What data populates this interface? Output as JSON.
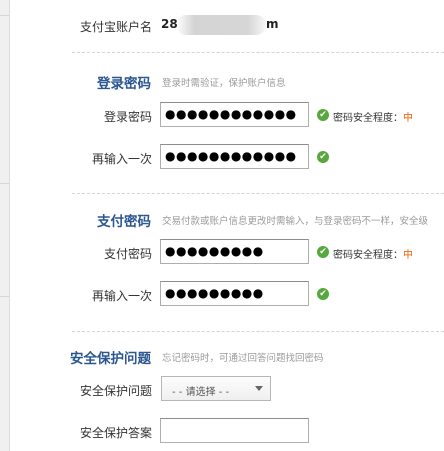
{
  "account": {
    "label": "支付宝账户名",
    "value_prefix": "28",
    "value_suffix": "m"
  },
  "login_section": {
    "title": "登录密码",
    "hint": "登录时需验证，保护账户信息",
    "password_label": "登录密码",
    "password_value": "●●●●●●●●●●●●",
    "confirm_label": "再输入一次",
    "confirm_value": "●●●●●●●●●●●●",
    "strength_label": "密码安全程度：",
    "strength_level": "中"
  },
  "pay_section": {
    "title": "支付密码",
    "hint": "交易付款或账户信息更改时需输入，与登录密码不一样，安全级",
    "password_label": "支付密码",
    "password_value": "●●●●●●●●●",
    "confirm_label": "再输入一次",
    "confirm_value": "●●●●●●●●●",
    "strength_label": "密码安全程度：",
    "strength_level": "中"
  },
  "security_section": {
    "title": "安全保护问题",
    "hint": "忘记密码时，可通过回答问题找回密码",
    "question_label": "安全保护问题",
    "question_select": "- - 请选择 - -",
    "answer_label": "安全保护答案",
    "answer_value": ""
  },
  "icons": {
    "check": "check-circle-icon",
    "dropdown": "chevron-down-icon"
  },
  "colors": {
    "section_title": "#2b5690",
    "check_green": "#56a83d",
    "strength_level": "#e85e00"
  }
}
